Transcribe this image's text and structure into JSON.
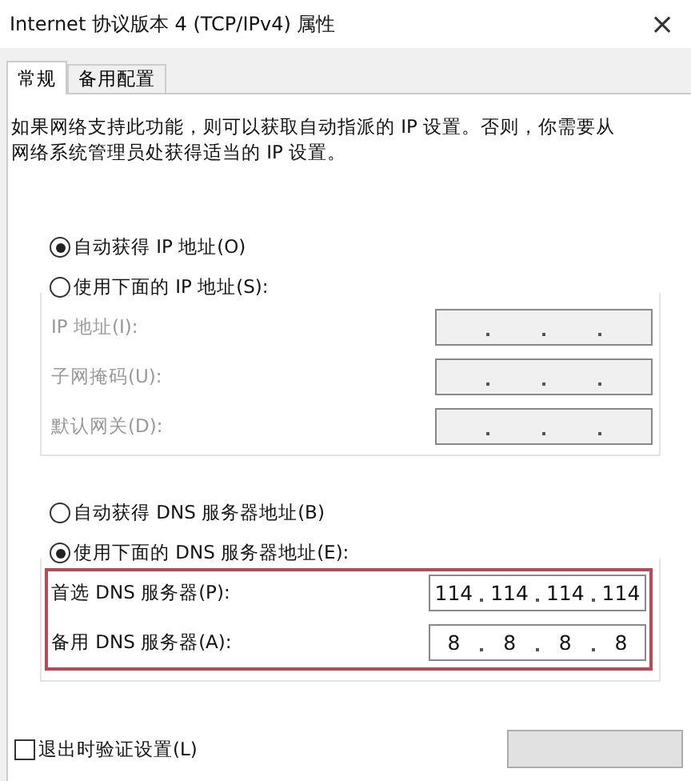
{
  "window": {
    "title": "Internet 协议版本 4 (TCP/IPv4) 属性",
    "close": "×"
  },
  "tabs": [
    {
      "label": "常规",
      "selected": true
    },
    {
      "label": "备用配置",
      "selected": false
    }
  ],
  "description": "如果网络支持此功能，则可以获取自动指派的 IP 设置。否则，你需要从网络系统管理员处获得适当的 IP 设置。",
  "ip_section": {
    "radios": [
      {
        "label": "自动获得 IP 地址(O)",
        "selected": true
      },
      {
        "label": "使用下面的 IP 地址(S):",
        "selected": false
      }
    ],
    "disabled": true,
    "fields": [
      {
        "label": "IP 地址(I):"
      },
      {
        "label": "子网掩码(U):"
      },
      {
        "label": "默认网关(D):"
      }
    ]
  },
  "dns_section": {
    "radios": [
      {
        "label": "自动获得 DNS 服务器地址(B)",
        "selected": false
      },
      {
        "label": "使用下面的 DNS 服务器地址(E):",
        "selected": true
      }
    ],
    "disabled": false,
    "highlighted": true,
    "fields": [
      {
        "label": "首选 DNS 服务器(P):",
        "octets": [
          "114",
          "114",
          "114",
          "114"
        ]
      },
      {
        "label": "备用 DNS 服务器(A):",
        "octets": [
          "8",
          "8",
          "8",
          "8"
        ]
      }
    ]
  },
  "validate_checkbox": {
    "label": "退出时验证设置(L)",
    "checked": false
  },
  "advanced_button": {
    "kind": "button"
  }
}
